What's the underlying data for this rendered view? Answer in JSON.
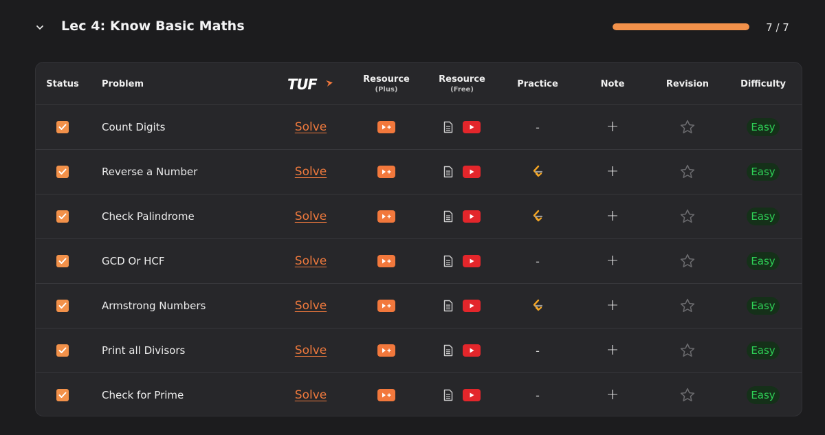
{
  "section": {
    "title": "Lec 4: Know Basic Maths",
    "progress_text": "7 / 7",
    "progress_fraction": 1.0
  },
  "colors": {
    "accent": "#f2914a",
    "solve": "#f07a3d",
    "youtube": "#e3262b",
    "easy_badge_text": "#2ecf56",
    "easy_badge_bg": "#153019"
  },
  "table": {
    "headers": {
      "status": "Status",
      "problem": "Problem",
      "tuf_logo": "TUF",
      "resource_plus": "Resource",
      "resource_plus_sub": "(Plus)",
      "resource_free": "Resource",
      "resource_free_sub": "(Free)",
      "practice": "Practice",
      "note": "Note",
      "revision": "Revision",
      "difficulty": "Difficulty"
    },
    "rows": [
      {
        "checked": true,
        "problem": "Count Digits",
        "solve": "Solve",
        "practice": "-",
        "note": "+",
        "difficulty": "Easy",
        "practice_icon": "none"
      },
      {
        "checked": true,
        "problem": "Reverse a Number",
        "solve": "Solve",
        "practice": "",
        "note": "+",
        "difficulty": "Easy",
        "practice_icon": "leetcode-icon"
      },
      {
        "checked": true,
        "problem": "Check Palindrome",
        "solve": "Solve",
        "practice": "",
        "note": "+",
        "difficulty": "Easy",
        "practice_icon": "leetcode-icon"
      },
      {
        "checked": true,
        "problem": "GCD Or HCF",
        "solve": "Solve",
        "practice": "-",
        "note": "+",
        "difficulty": "Easy",
        "practice_icon": "none"
      },
      {
        "checked": true,
        "problem": "Armstrong Numbers",
        "solve": "Solve",
        "practice": "",
        "note": "+",
        "difficulty": "Easy",
        "practice_icon": "leetcode-icon"
      },
      {
        "checked": true,
        "problem": "Print all Divisors",
        "solve": "Solve",
        "practice": "-",
        "note": "+",
        "difficulty": "Easy",
        "practice_icon": "none"
      },
      {
        "checked": true,
        "problem": "Check for Prime",
        "solve": "Solve",
        "practice": "-",
        "note": "+",
        "difficulty": "Easy",
        "practice_icon": "none"
      }
    ]
  }
}
